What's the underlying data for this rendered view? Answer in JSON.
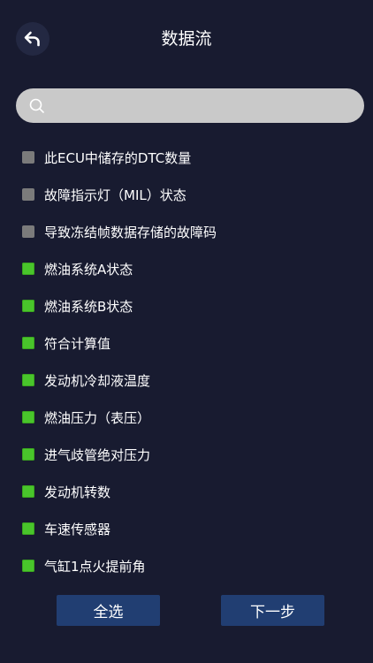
{
  "header": {
    "title": "数据流",
    "back_icon": "back-arrow-icon"
  },
  "search": {
    "value": "",
    "placeholder": "",
    "icon": "search-icon"
  },
  "colors": {
    "background": "#181b30",
    "checked": "#49c52b",
    "unchecked": "#7b7b7b",
    "button": "#213e72",
    "search_bg": "#c9c9c9"
  },
  "items": [
    {
      "label": "此ECU中储存的DTC数量",
      "checked": false
    },
    {
      "label": "故障指示灯（MIL）状态",
      "checked": false
    },
    {
      "label": "导致冻结帧数据存储的故障码",
      "checked": false
    },
    {
      "label": "燃油系统A状态",
      "checked": true
    },
    {
      "label": "燃油系统B状态",
      "checked": true
    },
    {
      "label": "符合计算值",
      "checked": true
    },
    {
      "label": "发动机冷却液温度",
      "checked": true
    },
    {
      "label": "燃油压力（表压）",
      "checked": true
    },
    {
      "label": "进气歧管绝对压力",
      "checked": true
    },
    {
      "label": "发动机转数",
      "checked": true
    },
    {
      "label": "车速传感器",
      "checked": true
    },
    {
      "label": "气缸1点火提前角",
      "checked": true
    }
  ],
  "footer": {
    "select_all_label": "全选",
    "next_label": "下一步"
  }
}
